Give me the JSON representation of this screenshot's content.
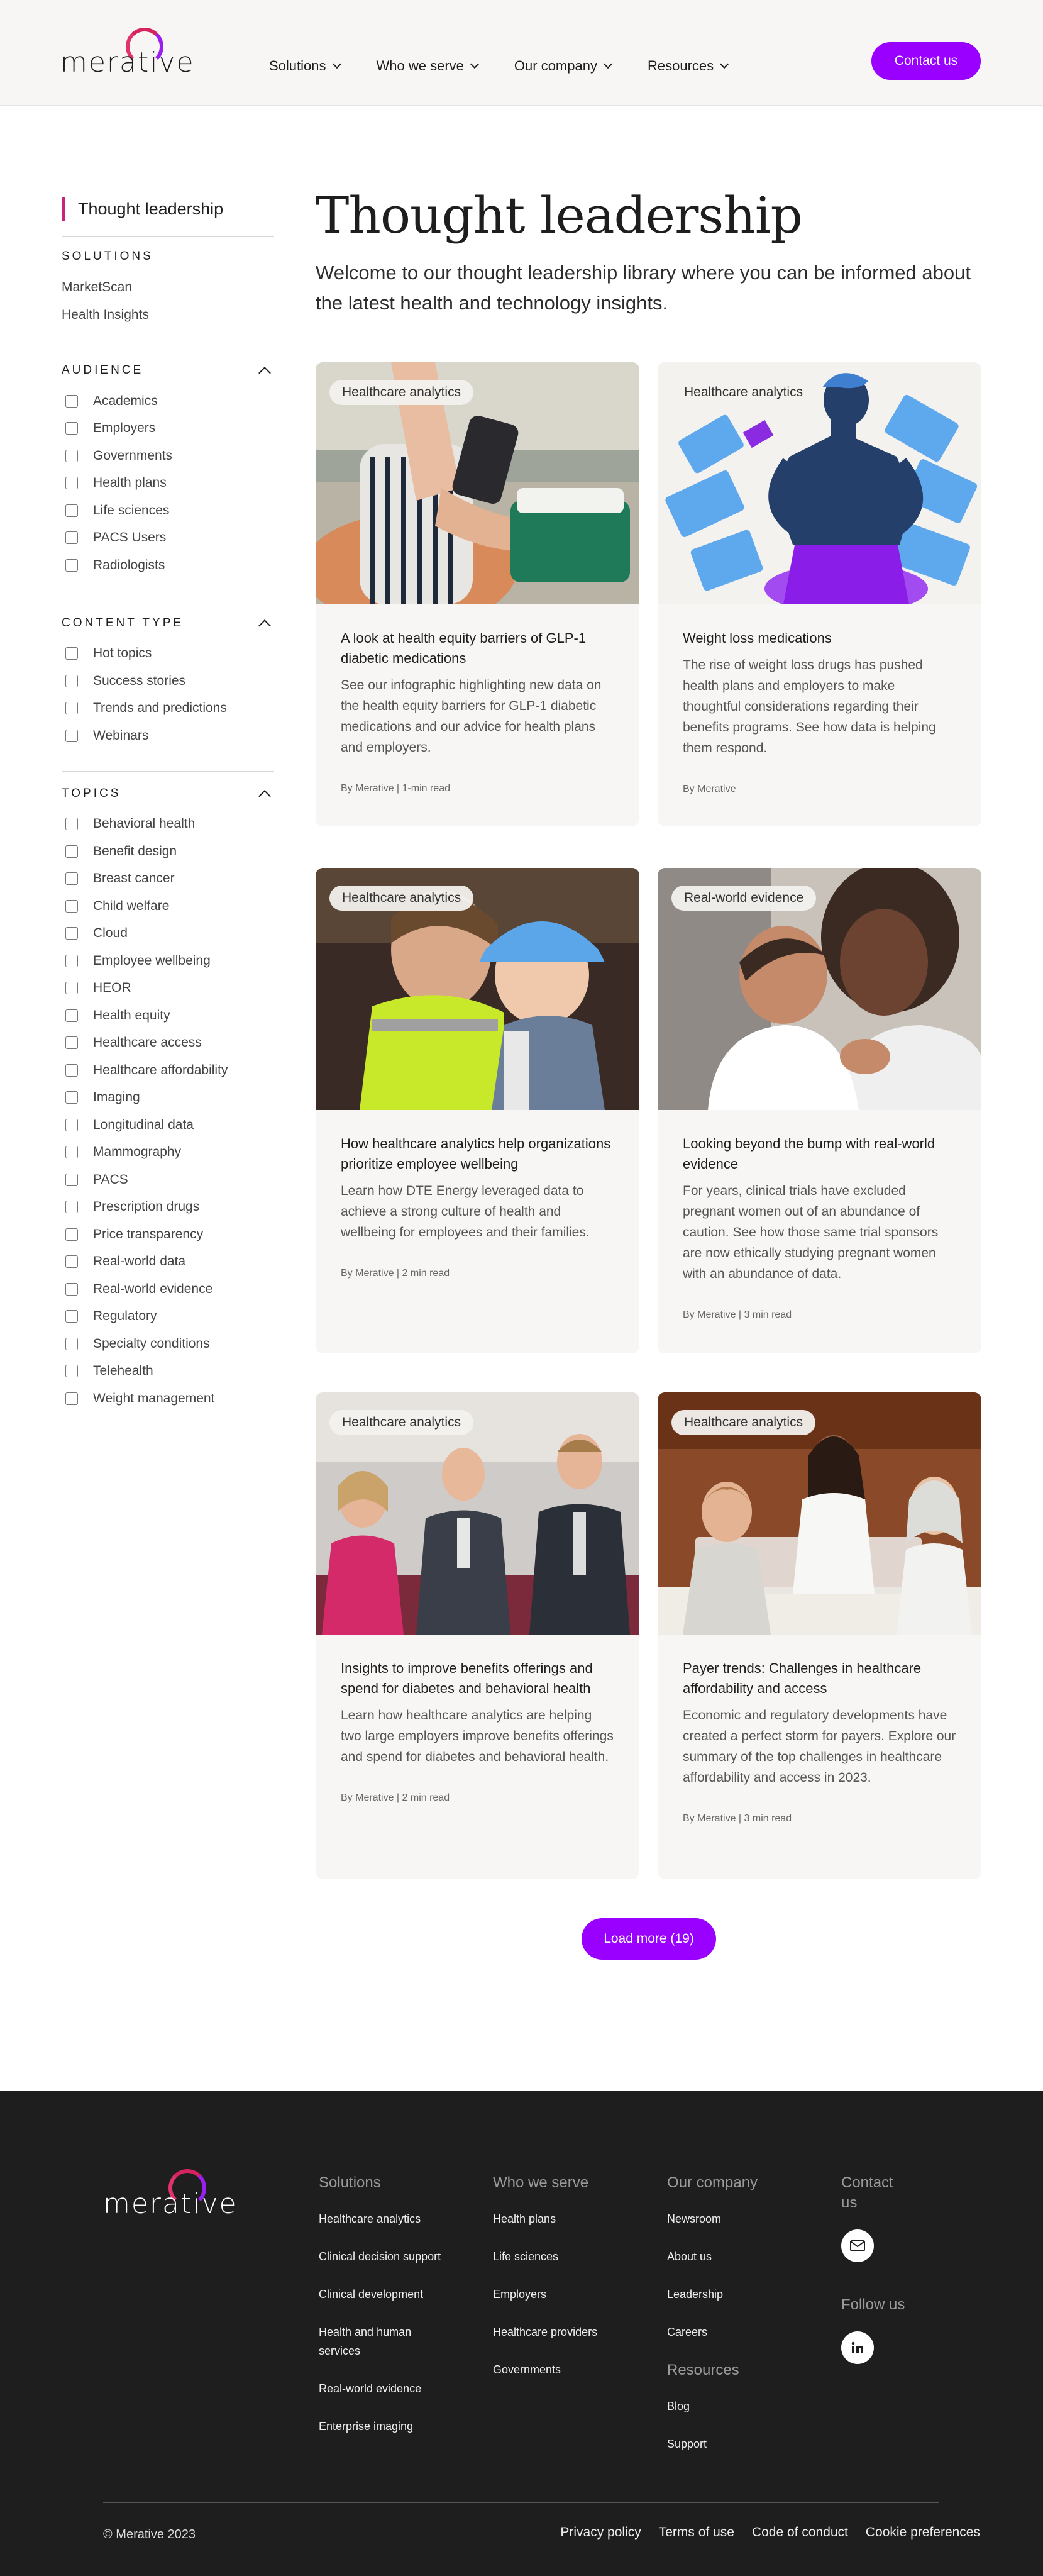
{
  "brand": {
    "name": "merative",
    "accent_color": "#9a00ff",
    "logo_gradient": [
      "#e0336b",
      "#9a1ff0"
    ]
  },
  "header": {
    "nav": [
      {
        "label": "Solutions",
        "icon": "chevron-down-icon"
      },
      {
        "label": "Who we serve",
        "icon": "chevron-down-icon"
      },
      {
        "label": "Our company",
        "icon": "chevron-down-icon"
      },
      {
        "label": "Resources",
        "icon": "chevron-down-icon"
      }
    ],
    "contact_label": "Contact us"
  },
  "sidebar": {
    "title": "Thought leadership",
    "solutions": {
      "heading": "SOLUTIONS",
      "links": [
        "MarketScan",
        "Health Insights"
      ]
    },
    "audience": {
      "heading": "AUDIENCE",
      "items": [
        "Academics",
        "Employers",
        "Governments",
        "Health plans",
        "Life sciences",
        "PACS Users",
        "Radiologists"
      ]
    },
    "content_type": {
      "heading": "CONTENT TYPE",
      "items": [
        "Hot topics",
        "Success stories",
        "Trends and predictions",
        "Webinars"
      ]
    },
    "topics": {
      "heading": "TOPICS",
      "items": [
        "Behavioral health",
        "Benefit design",
        "Breast cancer",
        "Child welfare",
        "Cloud",
        "Employee wellbeing",
        "HEOR",
        "Health equity",
        "Healthcare access",
        "Healthcare affordability",
        "Imaging",
        "Longitudinal data",
        "Mammography",
        "PACS",
        "Prescription drugs",
        "Price transparency",
        "Real-world data",
        "Real-world evidence",
        "Regulatory",
        "Specialty conditions",
        "Telehealth",
        "Weight management"
      ]
    }
  },
  "main": {
    "title": "Thought leadership",
    "intro": "Welcome to our thought leadership library where you can be informed about the latest health and technology insights.",
    "cards": [
      {
        "tag": "Healthcare analytics",
        "title": "A look at health equity barriers of GLP-1 diabetic medications",
        "desc": "See our infographic highlighting new data on the health equity barriers for GLP-1 diabetic medications and our advice for health plans and employers.",
        "meta": "By Merative | 1-min read"
      },
      {
        "tag": "Healthcare analytics",
        "title": "Weight loss medications",
        "desc": "The rise of weight loss drugs has pushed health plans and employers to make thoughtful considerations regarding their benefits programs. See how data is helping them respond.",
        "meta": "By Merative"
      },
      {
        "tag": "Healthcare analytics",
        "title": "How healthcare analytics help organizations prioritize employee wellbeing",
        "desc": "Learn how DTE Energy leveraged data to achieve a strong culture of health and wellbeing for employees and their families.",
        "meta": "By Merative | 2 min read"
      },
      {
        "tag": "Real-world evidence",
        "title": "Looking beyond the bump with real-world evidence",
        "desc": "For years, clinical trials have excluded pregnant women out of an abundance of caution. See how those same trial sponsors are now ethically studying pregnant women with an abundance of data.",
        "meta": "By Merative | 3 min read"
      },
      {
        "tag": "Healthcare analytics",
        "title": "Insights to improve benefits offerings and spend for diabetes and behavioral health",
        "desc": "Learn how healthcare analytics are helping two large employers improve benefits offerings and spend for diabetes and behavioral health.",
        "meta": "By Merative | 2 min read"
      },
      {
        "tag": "Healthcare analytics",
        "title": "Payer trends: Challenges in healthcare affordability and access",
        "desc": "Economic and regulatory developments have created a perfect storm for payers. Explore our summary of the top challenges in healthcare affordability and access in 2023.",
        "meta": "By Merative | 3 min read"
      }
    ],
    "load_more_label": "Load more (19)"
  },
  "footer": {
    "solutions": {
      "heading": "Solutions",
      "links": [
        "Healthcare analytics",
        "Clinical decision support",
        "Clinical development",
        "Health and human services",
        "Real-world evidence",
        "Enterprise imaging"
      ]
    },
    "who_we_serve": {
      "heading": "Who we serve",
      "links": [
        "Health plans",
        "Life sciences",
        "Employers",
        "Healthcare providers",
        "Governments"
      ]
    },
    "our_company": {
      "heading": "Our company",
      "links": [
        "Newsroom",
        "About us",
        "Leadership",
        "Careers"
      ]
    },
    "resources": {
      "heading": "Resources",
      "links": [
        "Blog",
        "Support"
      ]
    },
    "contact_heading": "Contact us",
    "follow_heading": "Follow us",
    "copyright": "© Merative 2023",
    "legal": [
      "Privacy policy",
      "Terms of use",
      "Code of conduct",
      "Cookie preferences"
    ]
  }
}
